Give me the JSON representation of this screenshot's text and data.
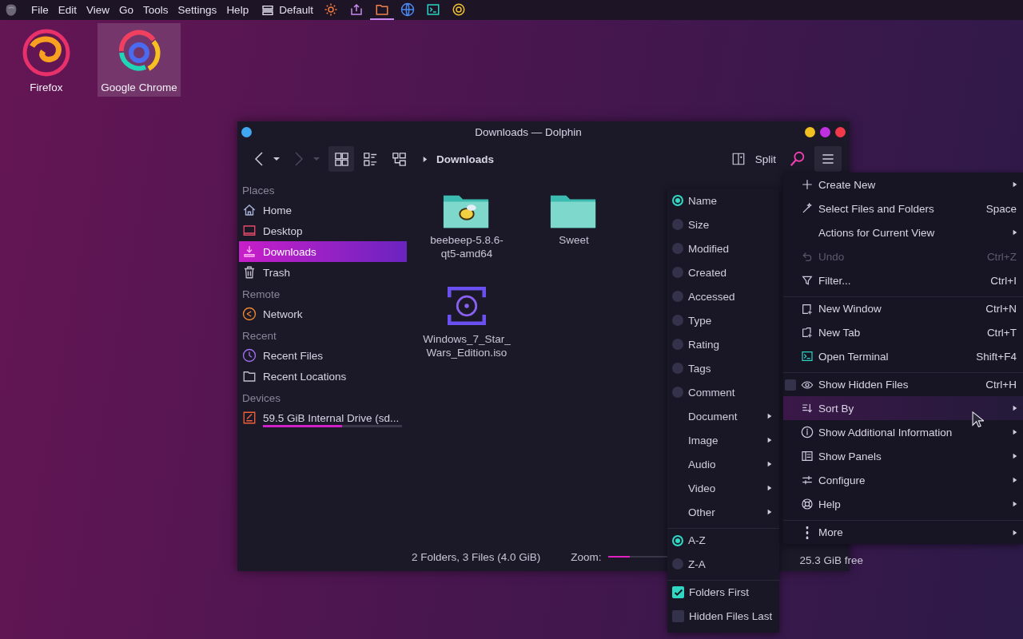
{
  "top_panel": {
    "menu": [
      {
        "label": "File"
      },
      {
        "label": "Edit"
      },
      {
        "label": "View"
      },
      {
        "label": "Go"
      },
      {
        "label": "Tools"
      },
      {
        "label": "Settings"
      },
      {
        "label": "Help"
      }
    ],
    "layout": "Default",
    "launchers": [
      {
        "selected": false
      },
      {
        "selected": false
      },
      {
        "selected": true
      },
      {
        "selected": false
      },
      {
        "selected": false
      },
      {
        "selected": false
      }
    ]
  },
  "desktop_icons": [
    {
      "label": "Firefox",
      "selected": false
    },
    {
      "label": "Google Chrome",
      "selected": true
    }
  ],
  "window": {
    "title": "Downloads — Dolphin",
    "toolbar": {
      "back": {
        "disabled": false
      },
      "forward": {
        "disabled": true
      },
      "view_modes": [
        {
          "selected": true
        },
        {
          "selected": false
        },
        {
          "selected": false
        }
      ],
      "breadcrumb": "Downloads",
      "split": "Split"
    },
    "sidebar": [
      {
        "heading": "Places",
        "items": [
          {
            "label": "Home",
            "selected": false
          },
          {
            "label": "Desktop",
            "selected": false
          },
          {
            "label": "Downloads",
            "selected": true
          },
          {
            "label": "Trash",
            "selected": false
          }
        ]
      },
      {
        "heading": "Remote",
        "items": [
          {
            "label": "Network",
            "selected": false
          }
        ]
      },
      {
        "heading": "Recent",
        "items": [
          {
            "label": "Recent Files",
            "selected": false
          },
          {
            "label": "Recent Locations",
            "selected": false
          }
        ]
      },
      {
        "heading": "Devices",
        "items": [
          {
            "label": "59.5 GiB Internal Drive (sd...",
            "selected": false,
            "level": 0.57
          }
        ]
      }
    ],
    "files": [
      {
        "name": "beebeep-5.8.6-qt5-amd64",
        "kind": "emblem-folder"
      },
      {
        "name": "Sweet",
        "kind": "folder"
      },
      {
        "name": "Windows_7_Star_Wars_Edition.iso",
        "kind": "disc-image"
      }
    ],
    "status_bar": {
      "summary": "2 Folders, 3 Files (4.0 GiB)",
      "zoom_label": "Zoom:",
      "zoom": {
        "level": 0.3
      },
      "free_space": "25.3 GiB free"
    }
  },
  "main_menu": [
    {
      "label": "Create New",
      "submenu": true,
      "disabled": false,
      "selected": false,
      "separated_above": false
    },
    {
      "label": "Select Files and Folders",
      "shortcut": "Space",
      "submenu": false,
      "disabled": false,
      "selected": false,
      "separated_above": false
    },
    {
      "label": "Actions for Current View",
      "submenu": true,
      "disabled": false,
      "selected": false,
      "separated_above": false
    },
    {
      "label": "Undo",
      "shortcut": "Ctrl+Z",
      "submenu": false,
      "disabled": true,
      "selected": false,
      "separated_above": false
    },
    {
      "label": "Filter...",
      "shortcut": "Ctrl+I",
      "submenu": false,
      "disabled": false,
      "selected": false,
      "separated_above": false
    },
    {
      "label": "New Window",
      "shortcut": "Ctrl+N",
      "submenu": false,
      "disabled": false,
      "selected": false,
      "separated_above": true
    },
    {
      "label": "New Tab",
      "shortcut": "Ctrl+T",
      "submenu": false,
      "disabled": false,
      "selected": false,
      "separated_above": false
    },
    {
      "label": "Open Terminal",
      "shortcut": "Shift+F4",
      "submenu": false,
      "disabled": false,
      "selected": false,
      "separated_above": false
    },
    {
      "label": "Show Hidden Files",
      "shortcut": "Ctrl+H",
      "submenu": false,
      "disabled": false,
      "selected": false,
      "separated_above": true,
      "checked": false
    },
    {
      "label": "Sort By",
      "submenu": true,
      "disabled": false,
      "selected": true,
      "separated_above": false
    },
    {
      "label": "Show Additional Information",
      "submenu": true,
      "disabled": false,
      "selected": false,
      "separated_above": false
    },
    {
      "label": "Show Panels",
      "submenu": true,
      "disabled": false,
      "selected": false,
      "separated_above": false
    },
    {
      "label": "Configure",
      "submenu": true,
      "disabled": false,
      "selected": false,
      "separated_above": false
    },
    {
      "label": "Help",
      "submenu": true,
      "disabled": false,
      "selected": false,
      "separated_above": false
    },
    {
      "label": "More",
      "submenu": true,
      "disabled": false,
      "selected": false,
      "separated_above": true
    }
  ],
  "sort_menu": [
    {
      "kind": "radio",
      "label": "Name",
      "selected": true,
      "separated_above": false
    },
    {
      "kind": "radio",
      "label": "Size",
      "selected": false,
      "separated_above": false
    },
    {
      "kind": "radio",
      "label": "Modified",
      "selected": false,
      "separated_above": false
    },
    {
      "kind": "radio",
      "label": "Created",
      "selected": false,
      "separated_above": false
    },
    {
      "kind": "radio",
      "label": "Accessed",
      "selected": false,
      "separated_above": false
    },
    {
      "kind": "radio",
      "label": "Type",
      "selected": false,
      "separated_above": false
    },
    {
      "kind": "radio",
      "label": "Rating",
      "selected": false,
      "separated_above": false
    },
    {
      "kind": "radio",
      "label": "Tags",
      "selected": false,
      "separated_above": false
    },
    {
      "kind": "radio",
      "label": "Comment",
      "selected": false,
      "separated_above": false
    },
    {
      "kind": "submenu",
      "label": "Document",
      "separated_above": false
    },
    {
      "kind": "submenu",
      "label": "Image",
      "separated_above": false
    },
    {
      "kind": "submenu",
      "label": "Audio",
      "separated_above": false
    },
    {
      "kind": "submenu",
      "label": "Video",
      "separated_above": false
    },
    {
      "kind": "submenu",
      "label": "Other",
      "separated_above": false
    },
    {
      "kind": "radio",
      "label": "A-Z",
      "selected": true,
      "separated_above": true
    },
    {
      "kind": "radio",
      "label": "Z-A",
      "selected": false,
      "separated_above": false
    },
    {
      "kind": "checkbox",
      "label": "Folders First",
      "checked": true,
      "separated_above": true
    },
    {
      "kind": "checkbox",
      "label": "Hidden Files Last",
      "checked": false,
      "separated_above": false
    }
  ]
}
